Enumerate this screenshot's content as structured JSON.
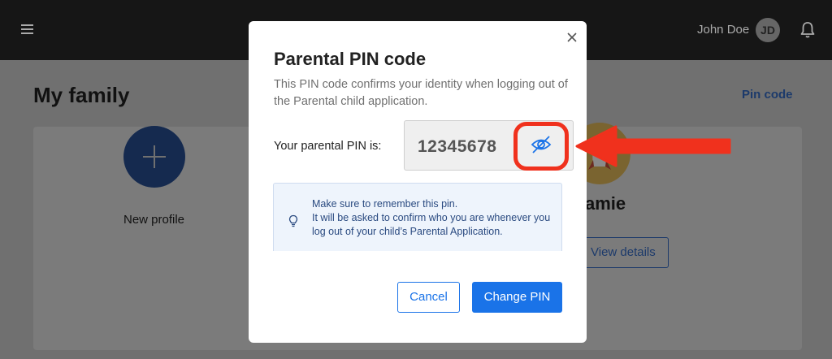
{
  "header": {
    "user_name": "John Doe",
    "user_initials": "JD"
  },
  "page": {
    "title": "My family",
    "pin_link": "Pin code",
    "new_profile_label": "New profile",
    "child_name": "amie",
    "view_details_label": "View details"
  },
  "modal": {
    "title": "Parental PIN code",
    "description": "This PIN code confirms your identity when logging out of the Parental child application.",
    "pin_label": "Your parental PIN is:",
    "pin_value": "12345678",
    "info_line1": "Make sure to remember this pin.",
    "info_line2": "It will be asked to confirm who you are whenever you log out of your child’s Parental Application.",
    "cancel_label": "Cancel",
    "change_label": "Change PIN"
  },
  "colors": {
    "primary": "#1a73e8",
    "annotation": "#f0311d",
    "overlay": "#6f6f6f"
  },
  "icons": [
    "menu-icon",
    "bell-icon",
    "close-icon",
    "eye-slash-icon",
    "lightbulb-icon",
    "plus-icon",
    "rocket-icon"
  ]
}
